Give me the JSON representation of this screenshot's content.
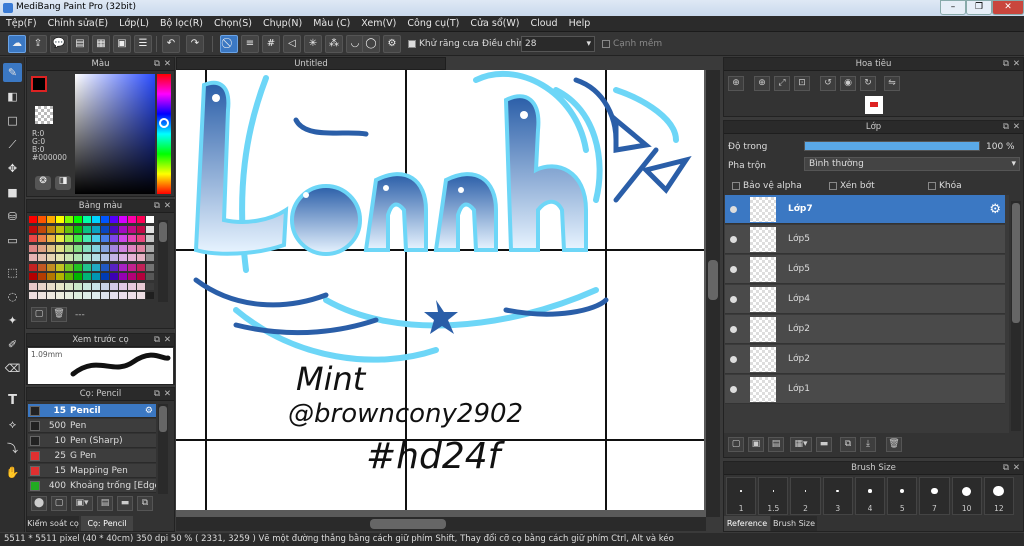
{
  "window": {
    "title": "MediBang Paint Pro (32bit)",
    "min": "–",
    "max": "❐",
    "close": "✕"
  },
  "menu": [
    "Tệp(F)",
    "Chỉnh sửa(E)",
    "Lớp(L)",
    "Bộ lọc(R)",
    "Chọn(S)",
    "Chụp(N)",
    "Màu (C)",
    "Xem(V)",
    "Công cụ(T)",
    "Cửa sổ(W)",
    "Cloud",
    "Help"
  ],
  "toolbar": {
    "antialias_label": "Khử răng cưa",
    "adjust_label": "Điều chỉnh",
    "adjust_value": "28",
    "edge_label": "Cạnh mềm"
  },
  "color_panel": {
    "title": "Màu",
    "r": "R:0",
    "g": "G:0",
    "b": "B:0",
    "hex": "#000000"
  },
  "palette_panel": {
    "title": "Bảng màu",
    "more": "---"
  },
  "preview_panel": {
    "title": "Xem trước cọ",
    "size": "1.09mm"
  },
  "brush_panel": {
    "title": "Cọ: Pencil",
    "items": [
      {
        "size": "15",
        "name": "Pencil",
        "color": "#222222",
        "selected": true
      },
      {
        "size": "500",
        "name": "Pen",
        "color": "#222222"
      },
      {
        "size": "10",
        "name": "Pen (Sharp)",
        "color": "#222222"
      },
      {
        "size": "25",
        "name": "G Pen",
        "color": "#e03030"
      },
      {
        "size": "15",
        "name": "Mapping Pen",
        "color": "#e03030"
      },
      {
        "size": "400",
        "name": "Khoảng trống [Edge]",
        "color": "#22aa22"
      }
    ],
    "tabs": [
      "Kiểm soát cọ",
      "Cọ: Pencil"
    ]
  },
  "document": {
    "tab": "Untitled"
  },
  "artwork": {
    "line1": "Linh",
    "mint": "Mint",
    "handle": "@browncony2902",
    "tag": "#hd24f"
  },
  "navigator_panel": {
    "title": "Hoa tiêu"
  },
  "layer_panel": {
    "title": "Lớp",
    "opacity_label": "Độ trong",
    "opacity_value": "100 %",
    "opacity": 1.0,
    "blend_label": "Pha trộn",
    "blend_value": "Bình thường",
    "protect_alpha": "Bảo vệ alpha",
    "clip": "Xén bớt",
    "lock": "Khóa",
    "layers": [
      "Lớp7",
      "Lớp5",
      "Lớp5",
      "Lớp4",
      "Lớp2",
      "Lớp2",
      "Lớp1"
    ]
  },
  "brush_size_panel": {
    "title": "Brush Size",
    "sizes": [
      "1",
      "1.5",
      "2",
      "3",
      "4",
      "5",
      "7",
      "10",
      "12"
    ],
    "tabs": [
      "Reference",
      "Brush Size"
    ]
  },
  "status": "5511 * 5511 pixel  (40 * 40cm)  350 dpi  50 %  ( 2331, 3259 )  Vẽ một đường thẳng bằng cách giữ phím Shift, Thay đổi cỡ cọ bằng cách giữ phím Ctrl, Alt và kéo",
  "colors": {
    "accent": "#3b78c3",
    "ink": "#2a5ea8",
    "cyan": "#6dd6f7"
  }
}
